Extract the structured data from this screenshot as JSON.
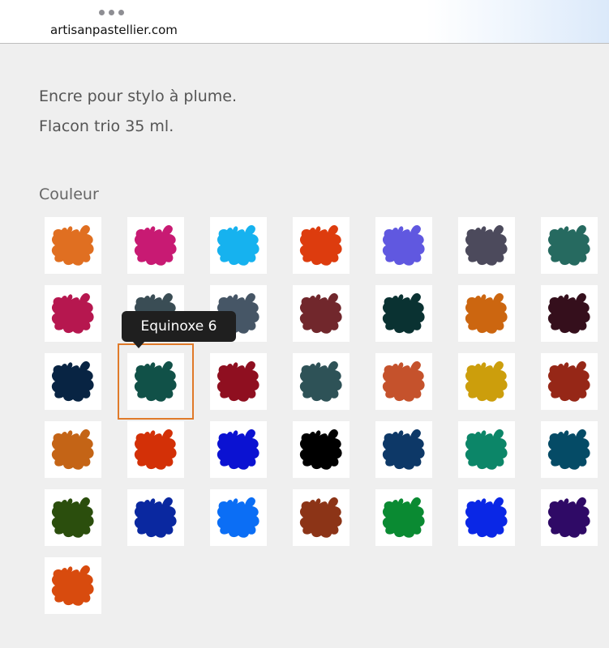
{
  "browser": {
    "url": "artisanpastellier.com"
  },
  "product": {
    "description_line1": "Encre pour stylo à  plume.",
    "description_line2": "Flacon trio 35 ml."
  },
  "color_picker": {
    "label": "Couleur",
    "tooltip": "Equinoxe 6",
    "selected_index": 15,
    "swatches": [
      "#e06f21",
      "#c81a73",
      "#16b2ef",
      "#dd3c0e",
      "#6058e0",
      "#4c4a5c",
      "#266a60",
      "#b6174f",
      "#3a4d55",
      "#465666",
      "#71272c",
      "#0a3232",
      "#cc6610",
      "#350f1c",
      "#082443",
      "#115148",
      "#8f0f20",
      "#2e5257",
      "#c5522c",
      "#cc9e0c",
      "#962717",
      "#c46416",
      "#d33007",
      "#0b12d2",
      "#000000",
      "#0d3867",
      "#0c8668",
      "#054b66",
      "#2b4e0d",
      "#0a28a0",
      "#0b6ef5",
      "#8c3417",
      "#0a8a32",
      "#0a27e6",
      "#2f0a66",
      "#d84b0e"
    ]
  }
}
